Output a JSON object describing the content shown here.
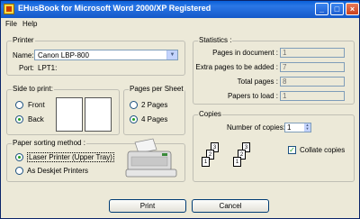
{
  "window": {
    "title": "EHusBook for Microsoft Word 2000/XP Registered"
  },
  "menu": {
    "file": "File",
    "help": "Help"
  },
  "printer": {
    "group_label": "Printer",
    "name_label": "Name:",
    "name_value": "Canon LBP-800",
    "port_label": "Port:",
    "port_value": "LPT1:"
  },
  "side_to_print": {
    "group_label": "Side to print:",
    "front": "Front",
    "back": "Back",
    "selected": "Back"
  },
  "pages_per_sheet": {
    "group_label": "Pages per Sheet",
    "two": "2 Pages",
    "four": "4 Pages",
    "selected": "4 Pages"
  },
  "paper_sorting": {
    "group_label": "Paper sorting method :",
    "laser": "Laser Printer (Upper Tray)",
    "deskjet": "As Deskjet Printers",
    "selected": "Laser Printer (Upper Tray)"
  },
  "statistics": {
    "group_label": "Statistics :",
    "pages_in_document_label": "Pages in document :",
    "pages_in_document_value": "1",
    "extra_pages_label": "Extra pages to be added :",
    "extra_pages_value": "7",
    "total_pages_label": "Total pages :",
    "total_pages_value": "8",
    "papers_to_load_label": "Papers to load :",
    "papers_to_load_value": "1"
  },
  "copies": {
    "group_label": "Copies",
    "number_label": "Number of copies:",
    "number_value": "1",
    "collate_label": "Collate copies",
    "collate_checked": true,
    "stack_numbers": [
      "3",
      "2",
      "1"
    ]
  },
  "buttons": {
    "print": "Print",
    "cancel": "Cancel"
  },
  "colors": {
    "titlebar": "#0a5fd8",
    "window_bg": "#ece9d8",
    "radio_dot": "#21a121"
  }
}
